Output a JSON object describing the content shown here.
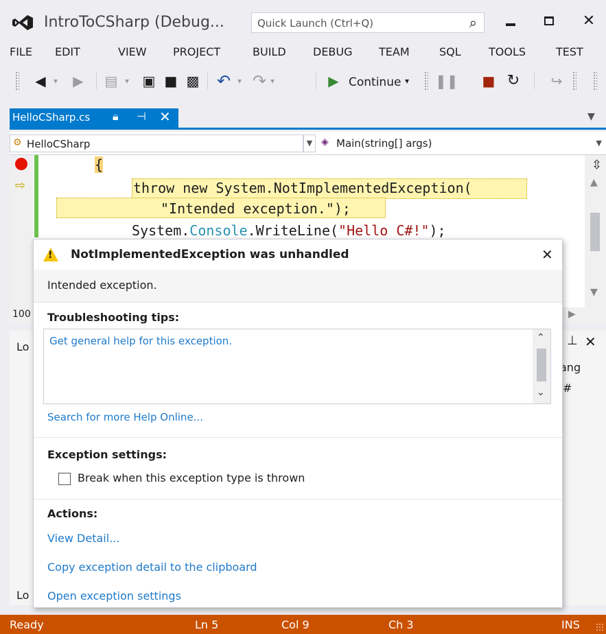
{
  "window": {
    "title": "IntroToCSharp (Debug...",
    "quick_launch_placeholder": "Quick Launch (Ctrl+Q)"
  },
  "menu": [
    "FILE",
    "EDIT",
    "VIEW",
    "PROJECT",
    "BUILD",
    "DEBUG",
    "TEAM",
    "SQL",
    "TOOLS",
    "TEST"
  ],
  "toolbar": {
    "continue_label": "Continue"
  },
  "document_tab": {
    "title": "HelloCSharp.cs"
  },
  "navigation": {
    "class": "HelloCSharp",
    "method": "Main(string[] args)"
  },
  "code": {
    "brace": "{",
    "line1_prefix": "throw new System.NotImplementedException(",
    "line2": "\"Intended exception.\");",
    "line3_system": "System.",
    "line3_console": "Console",
    "line3_call": ".WriteLine(",
    "line3_string": "\"Hello C#!\"",
    "line3_end": ");"
  },
  "zoom": "100",
  "panel": {
    "tab_prefix": "Lo",
    "col_lang": "ang",
    "col_hash": "#",
    "bottom_prefix": "Lo"
  },
  "exception": {
    "title": "NotImplementedException was unhandled",
    "message": "Intended exception.",
    "troubleshooting_header": "Troubleshooting tips:",
    "tip_link": "Get general help for this exception.",
    "search_help_link": "Search for more Help Online...",
    "settings_header": "Exception settings:",
    "break_checkbox_label": "Break when this exception type is thrown",
    "break_checked": false,
    "actions_header": "Actions:",
    "actions": [
      "View Detail...",
      "Copy exception detail to the clipboard",
      "Open exception settings"
    ]
  },
  "status": {
    "state": "Ready",
    "line": "Ln 5",
    "col": "Col 9",
    "ch": "Ch 3",
    "mode": "INS"
  },
  "colors": {
    "accent": "#007acc",
    "status_bar": "#ca5100",
    "link": "#1e7ac9",
    "breakpoint": "#e51400",
    "warning": "#f4c400"
  }
}
